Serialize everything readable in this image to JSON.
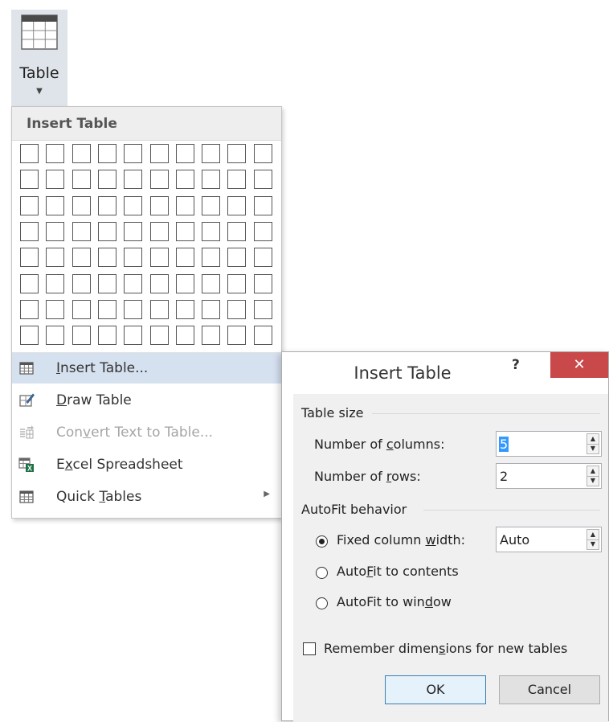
{
  "ribbon": {
    "table_label": "Table",
    "table_icon": "table-grid-icon",
    "dropdown_icon": "caret-down-icon"
  },
  "menu": {
    "header": "Insert Table",
    "grid": {
      "columns": 10,
      "rows": 8
    },
    "items": [
      {
        "pre": "",
        "key": "I",
        "post": "nsert Table...",
        "icon": "table-icon",
        "disabled": false,
        "highlight": true,
        "submenu": false
      },
      {
        "pre": "",
        "key": "D",
        "post": "raw Table",
        "icon": "draw-table-icon",
        "disabled": false,
        "highlight": false,
        "submenu": false
      },
      {
        "pre": "Con",
        "key": "v",
        "post": "ert Text to Table...",
        "icon": "convert-text-icon",
        "disabled": true,
        "highlight": false,
        "submenu": false
      },
      {
        "pre": "E",
        "key": "x",
        "post": "cel Spreadsheet",
        "icon": "excel-icon",
        "disabled": false,
        "highlight": false,
        "submenu": false
      },
      {
        "pre": "Quick ",
        "key": "T",
        "post": "ables",
        "icon": "quick-tables-icon",
        "disabled": false,
        "highlight": false,
        "submenu": true
      }
    ]
  },
  "dialog": {
    "title": "Insert Table",
    "help": "?",
    "close": "✕",
    "table_size": {
      "heading": "Table size",
      "columns_label": {
        "pre": "Number of ",
        "key": "c",
        "post": "olumns:"
      },
      "columns_value": "5",
      "rows_label": {
        "pre": "Number of ",
        "key": "r",
        "post": "ows:"
      },
      "rows_value": "2"
    },
    "autofit": {
      "heading": "AutoFit behavior",
      "fixed_label": {
        "pre": "Fixed column ",
        "key": "w",
        "post": "idth:"
      },
      "fixed_value": "Auto",
      "contents_label": {
        "pre": "Auto",
        "key": "F",
        "post": "it to contents"
      },
      "window_label": {
        "pre": "AutoFit to win",
        "key": "d",
        "post": "ow"
      },
      "selected": "fixed"
    },
    "remember": {
      "label": {
        "pre": "Remember dimen",
        "key": "s",
        "post": "ions for new tables"
      },
      "checked": false
    },
    "ok_label": "OK",
    "cancel_label": "Cancel"
  }
}
